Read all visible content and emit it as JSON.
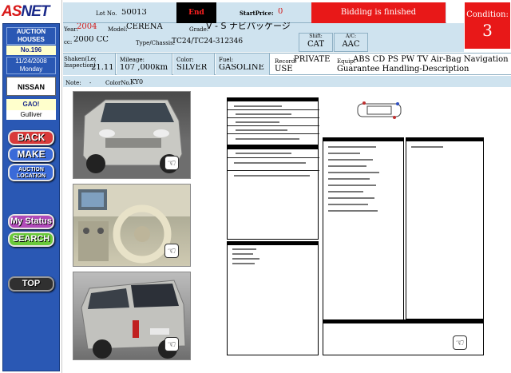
{
  "logo": {
    "part1": "AS",
    "part2": "NET"
  },
  "sidebar": {
    "auction_houses": "AUCTION HOUSES",
    "house_no": "No.196",
    "date": "11/24/2008",
    "weekday": "Monday",
    "make": "NISSAN",
    "user": "GAO!",
    "user2": "Gulliver",
    "buttons": {
      "back": "BACK",
      "make": "MAKE",
      "auction_location": "AUCTION LOCATION",
      "my_status": "My Status",
      "search": "SEARCH",
      "top": "TOP"
    }
  },
  "header": {
    "lot_label": "Lot No.",
    "lot_value": "50013",
    "end_label": "End",
    "start_price_label": "StartPrice:",
    "start_price_value": "0",
    "bidding_status": "Bidding is finished",
    "condition_label": "Condition:",
    "condition_value": "3",
    "year_label": "Year:",
    "year_value": "2004",
    "model_label": "Model:",
    "model_value": "CERENA",
    "grade_label": "Grade:",
    "grade_value": "V - S  ナビパッケージ",
    "cc_label": "cc:",
    "cc_value": "2000 CC",
    "type_label": "Type/Chassis:",
    "type_value": "TC24/TC24-312346",
    "shift_label": "Shift:",
    "shift_value": "CAT",
    "ac_label": "A/C:",
    "ac_value": "AAC",
    "shaken_label": "Shaken(Legal Inspection):",
    "shaken_value": "21.11",
    "mileage_label": "Mileage:",
    "mileage_value": "107 ,000km",
    "color_label": "Color:",
    "color_value": "SILVER",
    "fuel_label": "Fuel:",
    "fuel_value": "GASOLINE",
    "record_label": "Record:",
    "record_value": "PRIVATE USE",
    "equip_label": "Equip:",
    "equip_value": "ABS CD PS PW TV Air-Bag Navigation Guarantee Handling-Description",
    "note_label": "Note:",
    "note_value": "-",
    "color_no_label": "ColorNo.:",
    "color_no_value": "KY0"
  },
  "colors": {
    "header_bg": "#cfe3ef",
    "alert_red": "#e81818",
    "nav_blue": "#2a58b4"
  },
  "icons": [
    "hand-icon",
    "car-diagram-icon"
  ]
}
